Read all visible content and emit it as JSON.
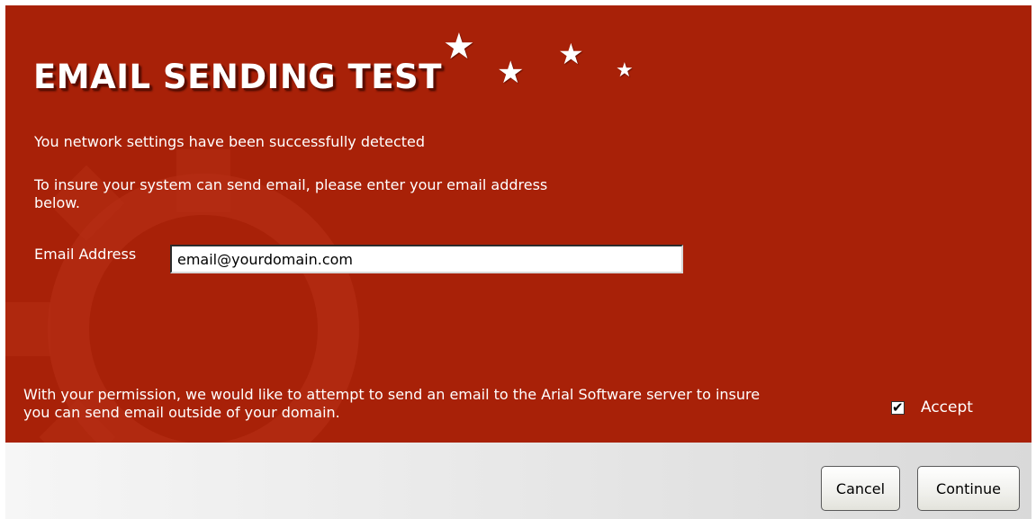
{
  "dialog": {
    "title": "EMAIL SENDING TEST",
    "status_message": "You network settings have been successfully detected",
    "instruction_line1": "To insure your system can send email, please enter your email address",
    "instruction_line2": "below.",
    "email_label": "Email Address",
    "email_value": "email@yourdomain.com",
    "permission_line1": "With your permission, we would like to attempt to send an email to the Arial Software server to insure",
    "permission_line2": "you can send email outside of your domain.",
    "accept_label": "Accept",
    "accept_checked": true
  },
  "buttons": {
    "cancel_label": "Cancel",
    "continue_label": "Continue"
  },
  "colors": {
    "banner_bg": "#a82108",
    "text": "#ffffff"
  },
  "icons": {
    "stars": "star-icon",
    "checkbox": "checkbox-checked-icon"
  }
}
